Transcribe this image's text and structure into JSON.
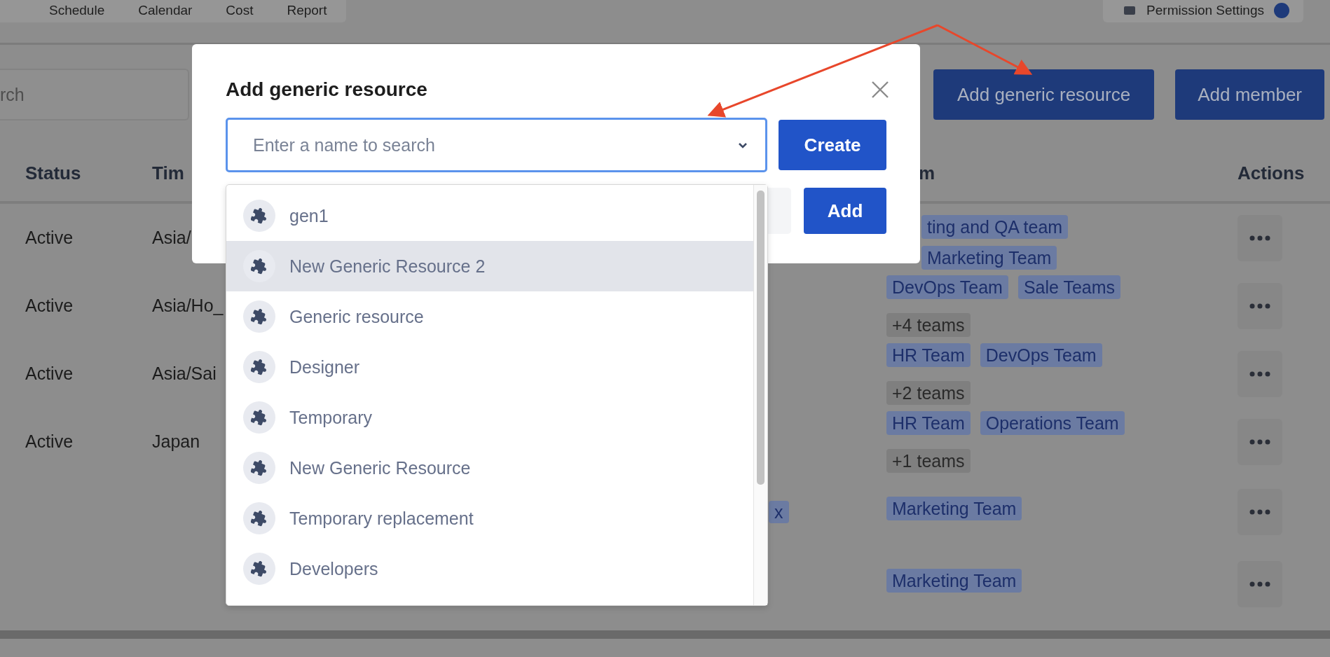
{
  "nav": {
    "tabs": [
      "Schedule",
      "Calendar",
      "Cost",
      "Report"
    ],
    "permission_button": "Permission Settings"
  },
  "toolbar": {
    "search": {
      "placeholder": "rch"
    },
    "buttons": [
      "Add generic resource",
      "Add member"
    ]
  },
  "table": {
    "columns": [
      "Status",
      "Tim",
      "m",
      "Actions"
    ],
    "rows": [
      {
        "status": "Active",
        "timezone": "Asia/",
        "column_3": [],
        "teams": [
          {
            "label": "ting and QA team",
            "kind": "team"
          },
          {
            "label": "Marketing Team",
            "kind": "team"
          }
        ]
      },
      {
        "status": "Active",
        "timezone": "Asia/Ho_",
        "column_3": [],
        "teams": [
          {
            "label": "DevOps Team",
            "kind": "team"
          },
          {
            "label": "Sale Teams",
            "kind": "team"
          },
          {
            "label": "+4 teams",
            "kind": "more"
          }
        ]
      },
      {
        "status": "Active",
        "timezone": "Asia/Sai",
        "column_3": [],
        "teams": [
          {
            "label": "HR Team",
            "kind": "team"
          },
          {
            "label": "DevOps Team",
            "kind": "team"
          },
          {
            "label": "+2 teams",
            "kind": "more"
          }
        ]
      },
      {
        "status": "Active",
        "timezone": "Japan",
        "column_3": [],
        "teams": [
          {
            "label": "HR Team",
            "kind": "team"
          },
          {
            "label": "Operations Team",
            "kind": "team"
          },
          {
            "label": "+1 teams",
            "kind": "more"
          }
        ]
      },
      {
        "status": "",
        "timezone": "",
        "column_3": [
          "x"
        ],
        "teams": [
          {
            "label": "Marketing Team",
            "kind": "team"
          }
        ]
      },
      {
        "status": "",
        "timezone": "",
        "column_3": [],
        "teams": [
          {
            "label": "Marketing Team",
            "kind": "team"
          }
        ]
      }
    ]
  },
  "modal": {
    "title": "Add generic resource",
    "search": {
      "placeholder": "Enter a name to search"
    },
    "create_button": "Create",
    "add_button": "Add",
    "options": [
      {
        "label": "gen1",
        "selected": false
      },
      {
        "label": "New Generic Resource 2",
        "selected": true
      },
      {
        "label": "Generic resource",
        "selected": false
      },
      {
        "label": "Designer",
        "selected": false
      },
      {
        "label": "Temporary",
        "selected": false
      },
      {
        "label": "New Generic Resource",
        "selected": false
      },
      {
        "label": "Temporary replacement",
        "selected": false
      },
      {
        "label": "Developers",
        "selected": false
      }
    ]
  }
}
